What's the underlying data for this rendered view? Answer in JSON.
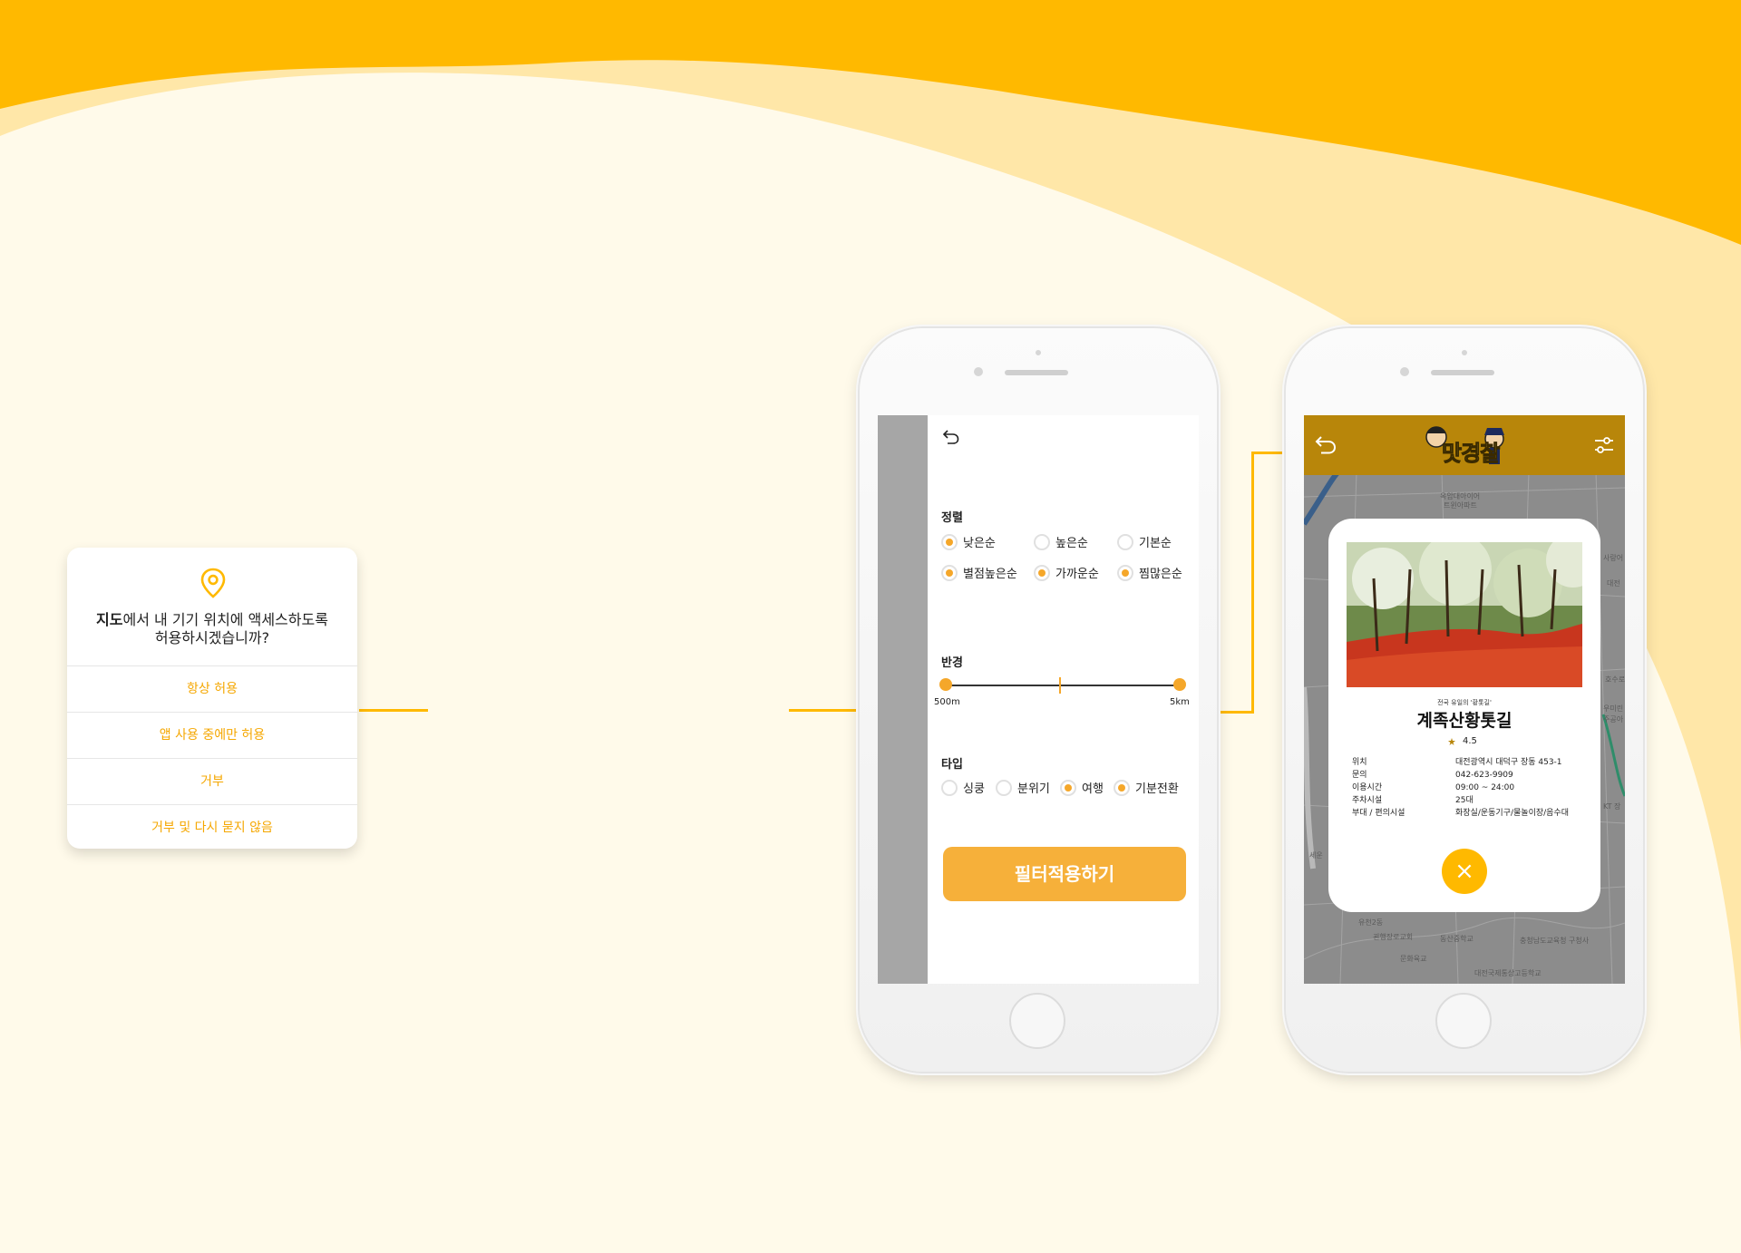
{
  "colors": {
    "accent": "#ffb900",
    "accent_light": "#ffe7a8",
    "background": "#fffaea",
    "button": "#f6b03a",
    "dim": "#a6a6a6",
    "topbar": "#b8860a"
  },
  "permission": {
    "question_bold": "지도",
    "question_rest": "에서 내 기기 위치에 액세스하도록",
    "question_line2": "허용하시겠습니까?",
    "icon": "location-pin-icon",
    "options": [
      "항상 허용",
      "앱 사용 중에만 허용",
      "거부",
      "거부 및 다시 묻지 않음"
    ]
  },
  "filter": {
    "back_icon": "back-arrow-icon",
    "sort": {
      "title": "정렬",
      "options": [
        {
          "label": "낮은순",
          "selected": true
        },
        {
          "label": "높은순",
          "selected": false
        },
        {
          "label": "기본순",
          "selected": false
        },
        {
          "label": "별점높은순",
          "selected": true
        },
        {
          "label": "가까운순",
          "selected": true
        },
        {
          "label": "찜많은순",
          "selected": true
        }
      ]
    },
    "radius": {
      "title": "반경",
      "min_label": "500m",
      "max_label": "5km"
    },
    "type": {
      "title": "타입",
      "options": [
        {
          "label": "싱쿵",
          "selected": false
        },
        {
          "label": "분위기",
          "selected": false
        },
        {
          "label": "여행",
          "selected": true
        },
        {
          "label": "기분전환",
          "selected": true
        }
      ]
    },
    "apply_label": "필터적용하기"
  },
  "detail": {
    "header": {
      "logo_text": "맛경찰",
      "back_icon": "back-arrow-icon",
      "settings_icon": "sliders-icon"
    },
    "place": {
      "subtitle": "전국 유일의 '황톳길'",
      "name": "계족산황톳길",
      "rating": "4.5",
      "info": [
        {
          "key": "위치",
          "value": "대전광역시 대덕구 장동 453-1"
        },
        {
          "key": "문의",
          "value": "042-623-9909"
        },
        {
          "key": "이용시간",
          "value": "09:00 ~ 24:00"
        },
        {
          "key": "주차시설",
          "value": "25대"
        },
        {
          "key": "부대 / 편의시설",
          "value": "화장실/운동기구/물놀이장/음수대"
        }
      ]
    },
    "close_label": "×",
    "map_labels": [
      "옥암대아이어",
      "트윈아파트",
      "유천2동",
      "괸행장로교회",
      "동산중학교",
      "충청남도교육청 구청사",
      "문화육교",
      "대전국제통상고등학교",
      "세운",
      "사랑어",
      "대전",
      "호수로",
      "우미린",
      "주공아",
      "KT 장"
    ]
  }
}
